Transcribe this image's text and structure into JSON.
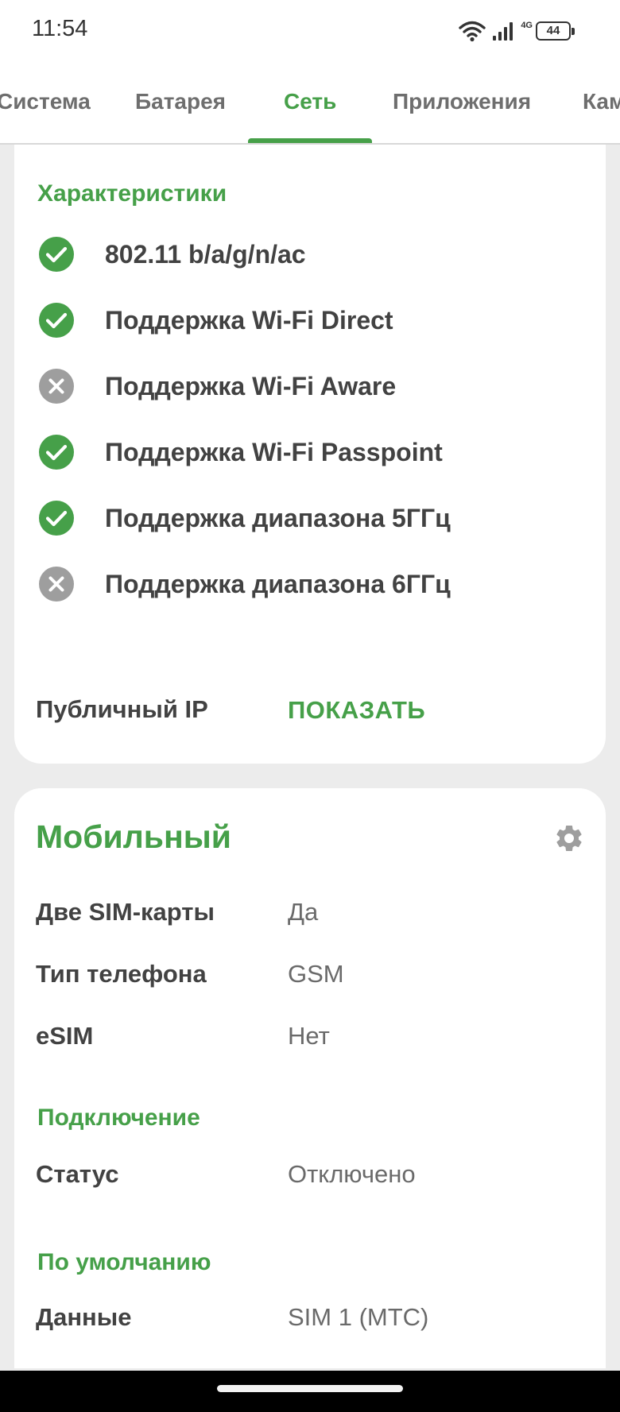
{
  "status_bar": {
    "time": "11:54",
    "network_type": "4G",
    "battery": "44"
  },
  "tabs": [
    {
      "label": "Система",
      "active": false
    },
    {
      "label": "Батарея",
      "active": false
    },
    {
      "label": "Сеть",
      "active": true
    },
    {
      "label": "Приложения",
      "active": false
    },
    {
      "label": "Кам",
      "active": false
    }
  ],
  "wifi_card": {
    "section_title": "Характеристики",
    "features": [
      {
        "label": "802.11 b/a/g/n/ac",
        "supported": true,
        "icon": "check-circle-icon"
      },
      {
        "label": "Поддержка Wi-Fi Direct",
        "supported": true,
        "icon": "check-circle-icon"
      },
      {
        "label": "Поддержка Wi-Fi Aware",
        "supported": false,
        "icon": "cross-circle-icon"
      },
      {
        "label": "Поддержка Wi-Fi Passpoint",
        "supported": true,
        "icon": "check-circle-icon"
      },
      {
        "label": "Поддержка диапазона 5ГГц",
        "supported": true,
        "icon": "check-circle-icon"
      },
      {
        "label": "Поддержка диапазона 6ГГц",
        "supported": false,
        "icon": "cross-circle-icon"
      }
    ],
    "public_ip_label": "Публичный IP",
    "public_ip_action": "ПОКАЗАТЬ"
  },
  "mobile_card": {
    "title": "Мобильный",
    "rows": [
      {
        "label": "Две SIM-карты",
        "value": "Да"
      },
      {
        "label": "Тип телефона",
        "value": "GSM"
      },
      {
        "label": "eSIM",
        "value": "Нет"
      }
    ],
    "connection_title": "Подключение",
    "connection_rows": [
      {
        "label": "Статус",
        "value": "Отключено"
      }
    ],
    "default_title": "По умолчанию",
    "default_rows": [
      {
        "label": "Данные",
        "value": "SIM 1 (МТС)"
      }
    ]
  },
  "colors": {
    "accent": "#46a049",
    "success": "#46a049",
    "disabled": "#9e9e9e",
    "background": "#ececec"
  }
}
